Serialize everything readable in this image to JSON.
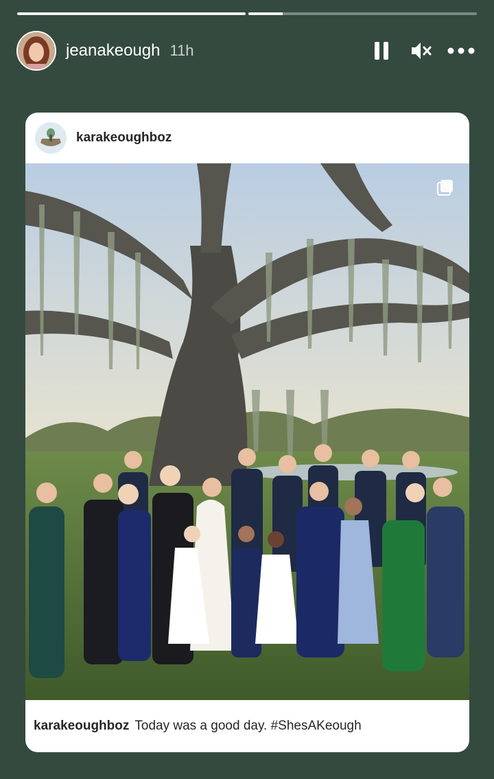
{
  "story": {
    "progress": [
      1.0,
      0.15
    ],
    "username": "jeanakeough",
    "time": "11h"
  },
  "controls": {
    "pause_icon": "pause-icon",
    "mute_icon": "speaker-muted-icon",
    "more_icon": "more-dots-icon"
  },
  "post": {
    "username": "karakeoughboz",
    "caption_user": "karakeoughboz",
    "caption_text": "Today was a good day. #ShesAKeough",
    "photo_subject": "wedding party in front of moss-covered oak"
  },
  "colors": {
    "background": "#344a3f",
    "card": "#ffffff",
    "text": "#262626"
  }
}
